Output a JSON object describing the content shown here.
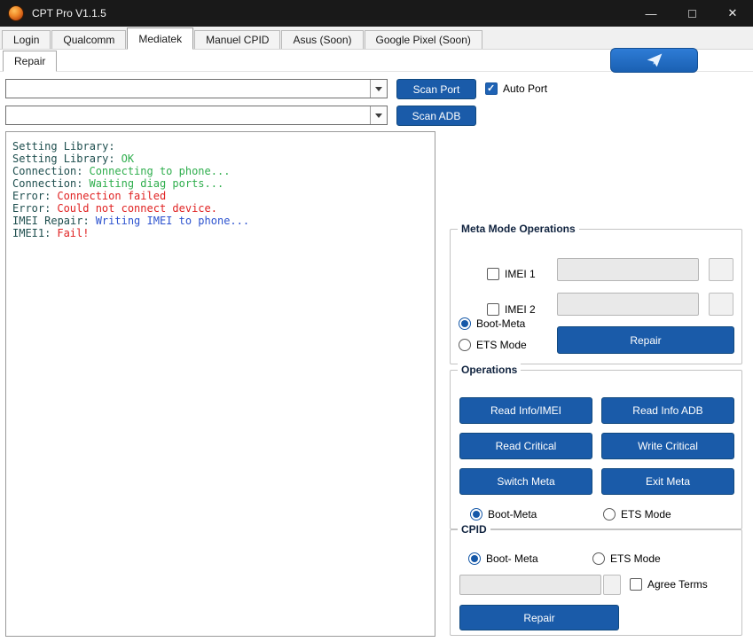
{
  "window": {
    "title": "CPT Pro V1.1.5",
    "minimize_glyph": "—",
    "close_glyph": "✕"
  },
  "tabs": [
    {
      "label": "Login",
      "selected": false
    },
    {
      "label": "Qualcomm",
      "selected": false
    },
    {
      "label": "Mediatek",
      "selected": true
    },
    {
      "label": "Manuel CPID",
      "selected": false
    },
    {
      "label": "Asus (Soon)",
      "selected": false
    },
    {
      "label": "Google Pixel (Soon)",
      "selected": false
    }
  ],
  "subtab": {
    "label": "Repair",
    "selected": true
  },
  "ports": {
    "port_combo_value": "",
    "adb_combo_value": "",
    "scan_port_label": "Scan Port",
    "scan_adb_label": "Scan ADB",
    "auto_port_label": "Auto Port",
    "auto_port_checked": true
  },
  "log": {
    "lines": [
      {
        "label": "Setting Library:",
        "value": "",
        "color": ""
      },
      {
        "label": "Setting Library:",
        "value": "OK",
        "color": "#2fae4d"
      },
      {
        "label": "Connection:",
        "value": "Connecting to phone...",
        "color": "#2fae4d"
      },
      {
        "label": "Connection:",
        "value": "Waiting diag ports...",
        "color": "#2fae4d"
      },
      {
        "label": "Error:",
        "value": "Connection failed",
        "color": "#e02222"
      },
      {
        "label": "Error:",
        "value": "Could not connect device.",
        "color": "#e02222"
      },
      {
        "label": "IMEI Repair:",
        "value": "Writing IMEI to phone...",
        "color": "#2d53cf"
      },
      {
        "label": "IMEI1:",
        "value": "Fail!",
        "color": "#e02222"
      }
    ]
  },
  "meta_mode": {
    "title": "Meta Mode Operations",
    "imei1_label": "IMEI 1",
    "imei1_checked": false,
    "imei1_value": "",
    "imei2_label": "IMEI 2",
    "imei2_checked": false,
    "imei2_value": "",
    "boot_meta_label": "Boot-Meta",
    "boot_meta_selected": true,
    "ets_mode_label": "ETS Mode",
    "ets_mode_selected": false,
    "repair_label": "Repair"
  },
  "operations": {
    "title": "Operations",
    "buttons": [
      "Read Info/IMEI",
      "Read Info ADB",
      "Read Critical",
      "Write Critical",
      "Switch Meta",
      "Exit Meta"
    ],
    "boot_meta_label": "Boot-Meta",
    "boot_meta_selected": true,
    "ets_mode_label": "ETS Mode",
    "ets_mode_selected": false
  },
  "cpid": {
    "title": "CPID",
    "boot_meta_label": "Boot- Meta",
    "boot_meta_selected": true,
    "ets_mode_label": "ETS Mode",
    "ets_mode_selected": false,
    "field_value": "",
    "agree_terms_label": "Agree Terms",
    "agree_terms_checked": false,
    "repair_label": "Repair"
  },
  "colors": {
    "titlebar_bg": "#191919",
    "accent_blue": "#1a5ba9",
    "log_label": "#1e4e4e",
    "log_green": "#2fae4d",
    "log_red": "#e02222",
    "log_blue": "#2d53cf"
  }
}
